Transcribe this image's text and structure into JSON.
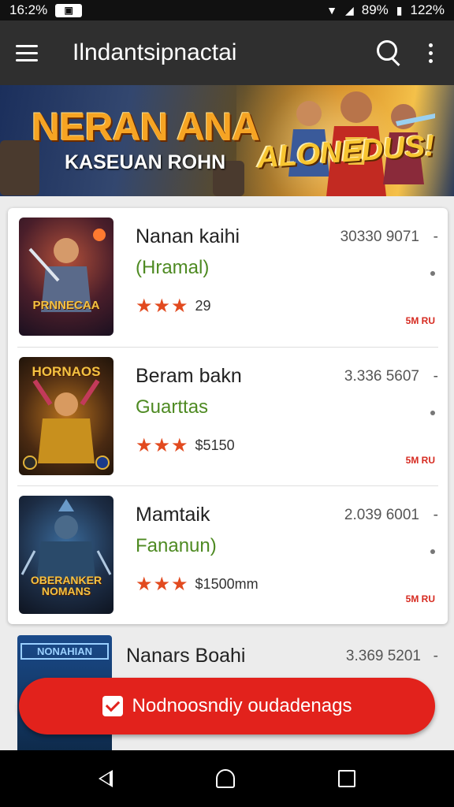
{
  "status_bar": {
    "time": "16:2%",
    "battery_text": "89%",
    "right_text": "122%",
    "icons": [
      "notification-box-icon",
      "signal-icon",
      "wifi-icon",
      "battery-icon"
    ]
  },
  "app_bar": {
    "title": "Ilndantsipnactai"
  },
  "banner": {
    "title": "NERAN ANA",
    "subtitle": "KASEUAN ROHN",
    "logo": "ALONEDUS!"
  },
  "items": [
    {
      "name": "Nanan kaihi",
      "subtitle": "(Hramal)",
      "stars": "★★★",
      "rating_text": "29",
      "count": "30330 9071",
      "dash": "-",
      "tag": "5M RU",
      "thumb_label": "PRNNECAA"
    },
    {
      "name": "Beram bakn",
      "subtitle": "Guarttas",
      "stars": "★★★",
      "rating_text": "$5150",
      "count": "3.336 5607",
      "dash": "-",
      "tag": "5M RU",
      "thumb_label": "HORNAOS"
    },
    {
      "name": "Mamtaik",
      "subtitle": "Fananun)",
      "stars": "★★★",
      "rating_text": "$1500mm",
      "count": "2.039 6001",
      "dash": "-",
      "tag": "5M RU",
      "thumb_label": "OBERANKER NOMANS"
    },
    {
      "name": "Nanars Boahi",
      "count": "3.369 5201",
      "dash": "-",
      "thumb_label": "NONAHIAN"
    }
  ],
  "fab": {
    "label": "Nodnoosndiy oudadenags"
  },
  "colors": {
    "accent_red": "#e2221c",
    "star": "#e24a1f",
    "subtitle_green": "#4e8a22",
    "app_bar": "#2f2f2f"
  }
}
